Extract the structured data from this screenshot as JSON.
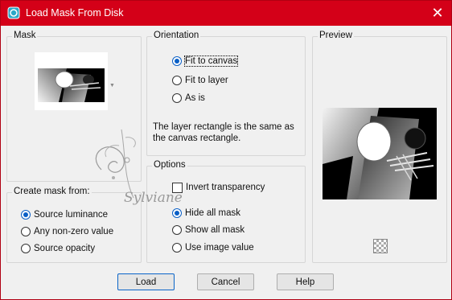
{
  "window": {
    "title": "Load Mask From Disk",
    "close_glyph": "✕"
  },
  "mask_group": {
    "label": "Mask"
  },
  "create_group": {
    "label": "Create mask from:",
    "options": [
      "Source luminance",
      "Any non-zero value",
      "Source opacity"
    ],
    "selected_index": 0
  },
  "orientation_group": {
    "label": "Orientation",
    "options": [
      "Fit to canvas",
      "Fit to layer",
      "As is"
    ],
    "selected_index": 0,
    "description": "The layer rectangle is the same as the canvas rectangle."
  },
  "options_group": {
    "label": "Options",
    "invert_label": "Invert transparency",
    "invert_checked": false,
    "radios": [
      "Hide all mask",
      "Show all mask",
      "Use image value"
    ],
    "selected_index": 0
  },
  "preview_group": {
    "label": "Preview"
  },
  "buttons": {
    "load": "Load",
    "cancel": "Cancel",
    "help": "Help"
  },
  "watermark": {
    "text": "Sylviane"
  },
  "colors": {
    "titlebar": "#d40018",
    "accent": "#0a5fc6"
  }
}
